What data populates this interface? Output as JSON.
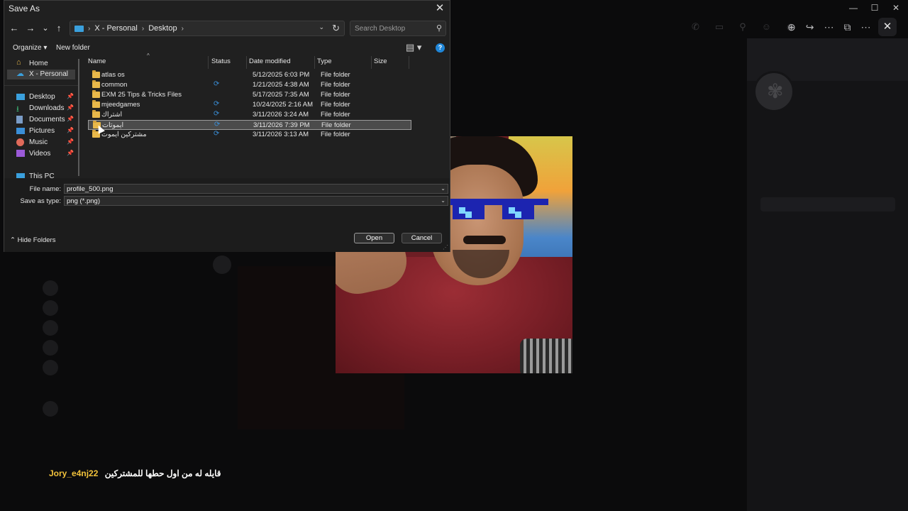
{
  "dialog": {
    "title": "Save As",
    "close_glyph": "✕",
    "nav": {
      "back": "←",
      "forward": "→",
      "recent": "⌄",
      "up": "↑"
    },
    "breadcrumb": [
      "X - Personal",
      "Desktop"
    ],
    "breadcrumb_sep": "›",
    "search_placeholder": "Search Desktop",
    "toolbar": {
      "organize": "Organize ▾",
      "new_folder": "New folder",
      "help": "?"
    },
    "nav_pane": [
      {
        "label": "Home",
        "icon": "home-icon"
      },
      {
        "label": "X - Personal",
        "icon": "cloud-icon",
        "selected": true
      },
      {
        "label": "Desktop",
        "icon": "desktop-icon",
        "pinned": true
      },
      {
        "label": "Downloads",
        "icon": "download-icon",
        "pinned": true
      },
      {
        "label": "Documents",
        "icon": "documents-icon",
        "pinned": true
      },
      {
        "label": "Pictures",
        "icon": "pictures-icon",
        "pinned": true
      },
      {
        "label": "Music",
        "icon": "music-icon",
        "pinned": true
      },
      {
        "label": "Videos",
        "icon": "videos-icon",
        "pinned": true
      },
      {
        "label": "This PC",
        "icon": "pc-icon"
      }
    ],
    "columns": {
      "name": "Name",
      "status": "Status",
      "date": "Date modified",
      "type": "Type",
      "size": "Size"
    },
    "files": [
      {
        "name": "atlas os",
        "status": "",
        "date": "5/12/2025 6:03 PM",
        "type": "File folder"
      },
      {
        "name": "common",
        "status": "⟳",
        "date": "1/21/2025 4:38 AM",
        "type": "File folder"
      },
      {
        "name": "EXM 25 Tips & Tricks Files",
        "status": "",
        "date": "5/17/2025 7:35 AM",
        "type": "File folder"
      },
      {
        "name": "mjeedgames",
        "status": "⟳",
        "date": "10/24/2025 2:16 AM",
        "type": "File folder"
      },
      {
        "name": "اشتراك",
        "status": "⟳",
        "date": "3/11/2026 3:24 AM",
        "type": "File folder"
      },
      {
        "name": "ايموتات",
        "status": "⟳",
        "date": "3/11/2026 7:39 PM",
        "type": "File folder",
        "selected": true
      },
      {
        "name": "مشتركين ايموت",
        "status": "⟳",
        "date": "3/11/2026 3:13 AM",
        "type": "File folder"
      }
    ],
    "file_name_label": "File name:",
    "file_name_value": "profile_500.png",
    "save_type_label": "Save as type:",
    "save_type_value": "png (*.png)",
    "hide_folders": "Hide Folders",
    "open_button": "Open",
    "cancel_button": "Cancel"
  },
  "chat": {
    "username": "Jory_e4nj22",
    "message": "قايله له من اول حطها للمشتركين",
    "username_color": "#f2c23b"
  },
  "window_controls": {
    "minimize": "—",
    "maximize": "☐",
    "close": "✕"
  },
  "colors": {
    "accent": "#1f86d8",
    "sync_status": "#3a8fd8",
    "folder": "#e8b84a"
  }
}
